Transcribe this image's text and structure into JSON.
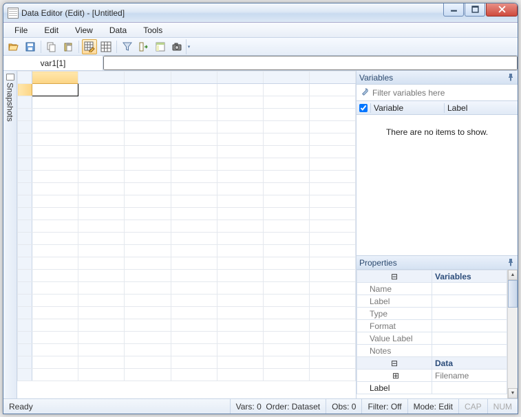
{
  "window": {
    "title": "Data Editor (Edit) - [Untitled]"
  },
  "menu": {
    "file": "File",
    "edit": "Edit",
    "view": "View",
    "data": "Data",
    "tools": "Tools"
  },
  "reference": {
    "name": "var1[1]",
    "value": ""
  },
  "sidebar": {
    "snapshots": "Snapshots"
  },
  "variables_panel": {
    "title": "Variables",
    "filter_placeholder": "Filter variables here",
    "col_variable": "Variable",
    "col_label": "Label",
    "empty": "There are no items to show."
  },
  "properties_panel": {
    "title": "Properties",
    "groups": {
      "variables": "Variables",
      "data": "Data"
    },
    "rows": {
      "name": "Name",
      "label": "Label",
      "type": "Type",
      "format": "Format",
      "value_label": "Value Label",
      "notes": "Notes",
      "filename": "Filename",
      "data_label": "Label"
    }
  },
  "status": {
    "ready": "Ready",
    "vars": "Vars: 0",
    "order": "Order: Dataset",
    "obs": "Obs: 0",
    "filter": "Filter: Off",
    "mode": "Mode: Edit",
    "cap": "CAP",
    "num": "NUM"
  }
}
